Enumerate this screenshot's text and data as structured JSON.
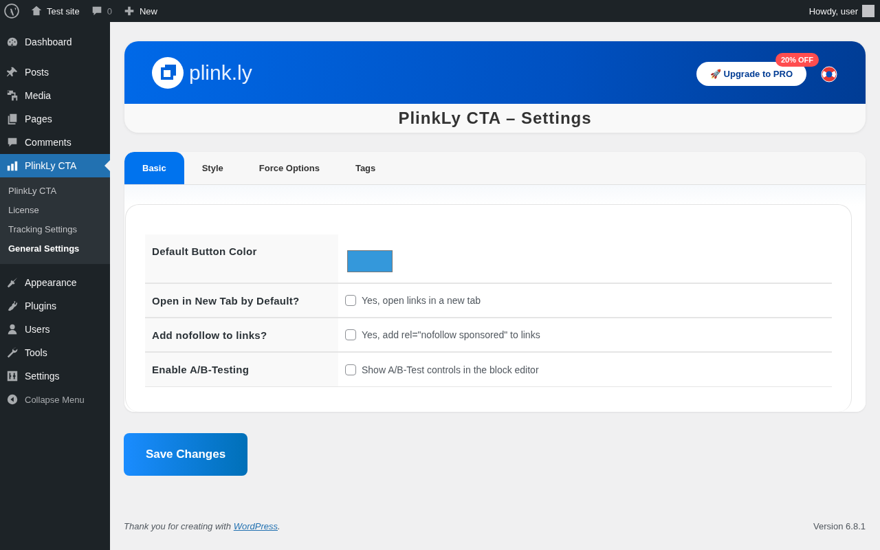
{
  "admin_bar": {
    "site": "Test site",
    "comments": "0",
    "new": "New",
    "howdy": "Howdy, user"
  },
  "sidebar": {
    "items": [
      {
        "label": "Dashboard",
        "selected": false
      },
      {
        "label": "Posts",
        "selected": false
      },
      {
        "label": "Media",
        "selected": false
      },
      {
        "label": "Pages",
        "selected": false
      },
      {
        "label": "Comments",
        "selected": false
      },
      {
        "label": "PlinkLy CTA",
        "selected": true,
        "children": [
          {
            "label": "PlinkLy CTA",
            "selected": false
          },
          {
            "label": "License",
            "selected": false
          },
          {
            "label": "Tracking Settings",
            "selected": false
          },
          {
            "label": "General Settings",
            "selected": true
          }
        ]
      },
      {
        "label": "Appearance",
        "selected": false
      },
      {
        "label": "Plugins",
        "selected": false
      },
      {
        "label": "Users",
        "selected": false
      },
      {
        "label": "Tools",
        "selected": false
      },
      {
        "label": "Settings",
        "selected": false
      }
    ],
    "collapse": "Collapse Menu"
  },
  "header": {
    "logo": "plink.ly",
    "upgrade": "🚀 Upgrade to PRO",
    "badge": "20% OFF",
    "title": "PlinkLy CTA – Settings"
  },
  "tabs": [
    {
      "label": "Basic",
      "selected": true
    },
    {
      "label": "Style",
      "selected": false
    },
    {
      "label": "Force Options",
      "selected": false
    },
    {
      "label": "Tags",
      "selected": false
    }
  ],
  "settings": [
    {
      "kind": "color",
      "label": "Default Button Color",
      "color": "#3498db"
    },
    {
      "kind": "checkbox",
      "label": "Open in New Tab by Default?",
      "option": "Yes, open links in a new tab",
      "checked": false
    },
    {
      "kind": "checkbox",
      "label": "Add nofollow to links?",
      "option": "Yes, add rel=\"nofollow sponsored\" to links",
      "checked": false
    },
    {
      "kind": "checkbox",
      "label": "Enable A/B-Testing",
      "option": "Show A/B-Test controls in the block editor",
      "checked": false
    }
  ],
  "save_button": "Save Changes",
  "footer": {
    "thanks": "Thank you for creating with ",
    "link": "WordPress",
    "end": ".",
    "version": "Version 6.8.1"
  }
}
